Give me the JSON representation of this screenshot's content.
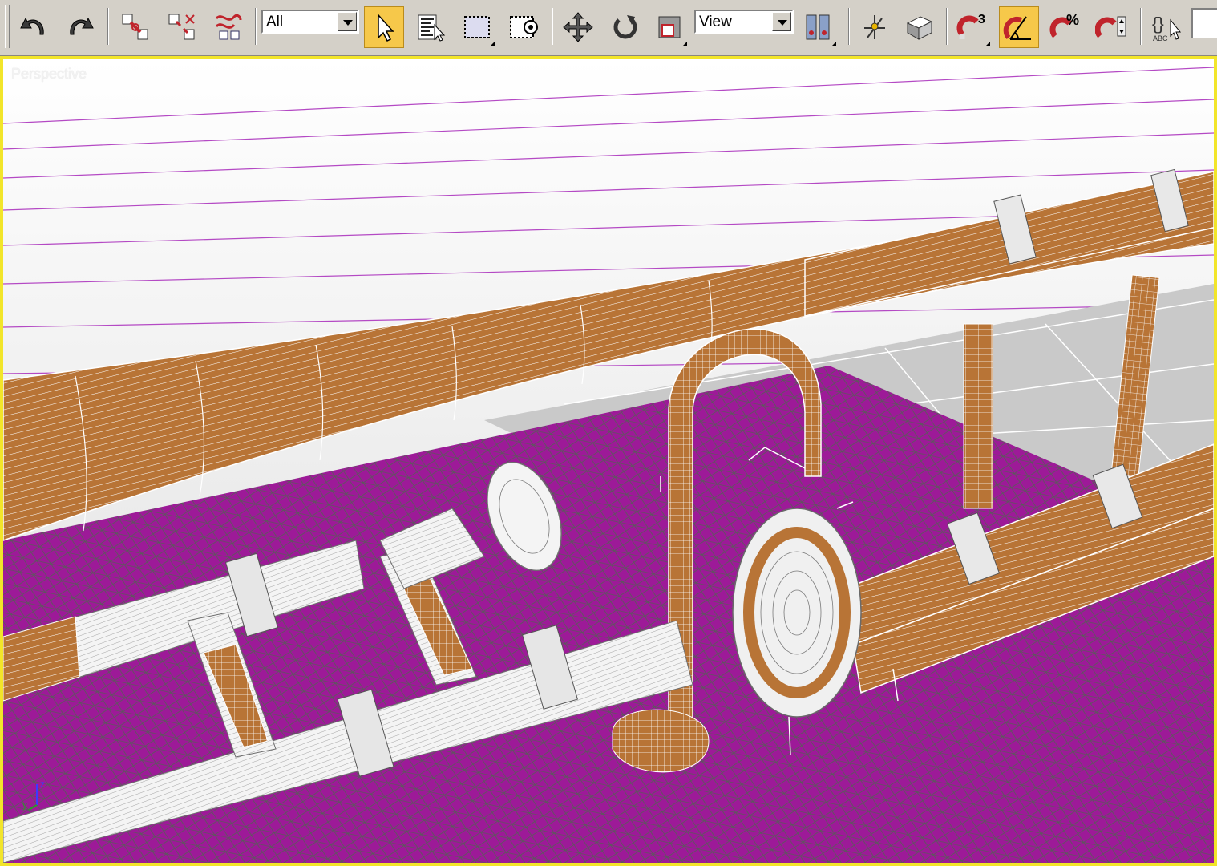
{
  "toolbar": {
    "selection_filter": {
      "value": "All"
    },
    "coordinate_system": {
      "value": "View"
    },
    "snap_toggle_label": "3",
    "percent_snap_label": "%",
    "named_selection_label": "ABC",
    "buttons": [
      {
        "name": "undo",
        "icon": "undo-icon"
      },
      {
        "name": "redo",
        "icon": "redo-icon"
      },
      {
        "name": "select-and-link",
        "icon": "link-icon"
      },
      {
        "name": "unlink-selection",
        "icon": "unlink-icon"
      },
      {
        "name": "bind-to-space-warp",
        "icon": "bind-spacewarp-icon"
      },
      {
        "name": "select-object",
        "icon": "cursor-arrow-icon",
        "active": true
      },
      {
        "name": "select-by-name",
        "icon": "select-by-name-icon"
      },
      {
        "name": "rectangular-selection-region",
        "icon": "rect-selection-icon"
      },
      {
        "name": "window-crossing",
        "icon": "window-crossing-icon"
      },
      {
        "name": "select-and-move",
        "icon": "move-icon"
      },
      {
        "name": "select-and-rotate",
        "icon": "rotate-icon"
      },
      {
        "name": "select-and-scale",
        "icon": "scale-icon"
      },
      {
        "name": "use-pivot-point-center",
        "icon": "pivot-center-icon"
      },
      {
        "name": "select-and-manipulate",
        "icon": "manipulate-icon"
      },
      {
        "name": "keyboard-shortcut-override",
        "icon": "keyboard-override-icon"
      },
      {
        "name": "snaps-toggle",
        "icon": "magnet-snap-icon"
      },
      {
        "name": "angle-snap-toggle",
        "icon": "angle-snap-icon",
        "active": true
      },
      {
        "name": "percent-snap-toggle",
        "icon": "percent-snap-icon"
      },
      {
        "name": "spinner-snap-toggle",
        "icon": "spinner-snap-icon"
      },
      {
        "name": "edit-named-selection-sets",
        "icon": "named-selection-icon"
      }
    ]
  },
  "viewport": {
    "label": "Perspective",
    "border_color": "#f2e52a",
    "ground_color": "#a0189a",
    "brass_color": "#b8763a",
    "wire_color": "#ffffff",
    "axis_tripod": {
      "z": "z",
      "y": "y"
    }
  }
}
